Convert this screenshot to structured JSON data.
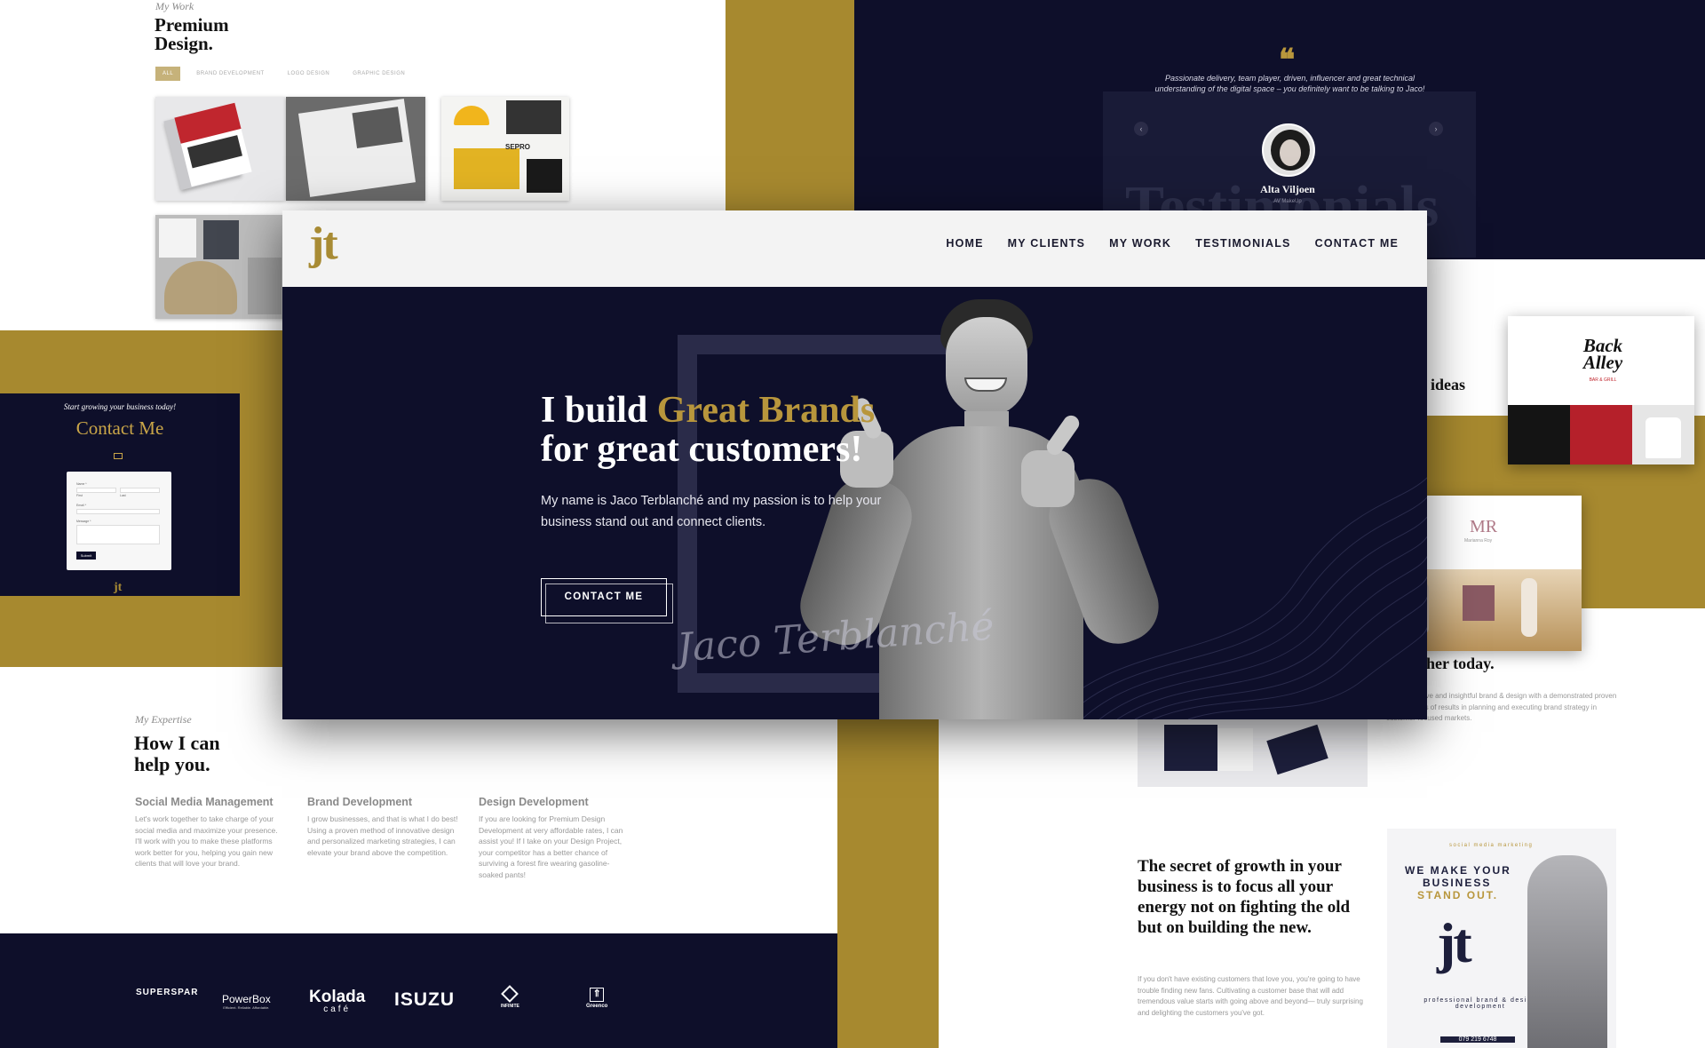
{
  "colors": {
    "navy": "#0e0f2a",
    "gold": "#a7892f",
    "accent_gold_text": "#b8963c"
  },
  "work": {
    "kicker": "My Work",
    "title_line1": "Premium",
    "title_line2": "Design.",
    "filters": [
      "ALL",
      "BRAND DEVELOPMENT",
      "LOGO DESIGN",
      "GRAPHIC DESIGN"
    ],
    "sepro_label": "SEPRO"
  },
  "testimonial": {
    "quote": "Passionate delivery, team player, driven, influencer and great technical understanding of the digital space – you definitely want to be talking to Jaco!",
    "name": "Alta Viljoen",
    "role": "AV MakeUp",
    "bg_word": "Testimonials"
  },
  "contact_section": {
    "tagline": "Start growing your business today!",
    "title": "Contact Me",
    "form": {
      "name_label": "Name *",
      "first": "First",
      "last": "Last",
      "email_label": "Email *",
      "message_label": "Message *",
      "submit": "Submit"
    },
    "footer_logo": "jt"
  },
  "header": {
    "logo": "jt",
    "nav": [
      "HOME",
      "MY CLIENTS",
      "MY WORK",
      "TESTIMONIALS",
      "CONTACT ME"
    ]
  },
  "hero": {
    "heading_pre": "I build ",
    "heading_gold": "Great Brands",
    "heading_line2": "for great customers!",
    "paragraph": "My name is Jaco Terblanché and my passion is to help your business stand out and connect clients.",
    "cta": "CONTACT ME",
    "signature": "Jaco Terblanché"
  },
  "expertise": {
    "kicker": "My Expertise",
    "title_line1": "How I can",
    "title_line2": "help you.",
    "columns": [
      {
        "title": "Social Media Management",
        "text": "Let's work together to take charge of your social media and maximize your presence. I'll work with you to make these platforms work better for you, helping you gain new clients that will love your brand."
      },
      {
        "title": "Brand Development",
        "text": "I grow businesses, and that is what I do best! Using a proven method of innovative design and personalized marketing strategies, I can elevate your brand above the competition."
      },
      {
        "title": "Design Development",
        "text": "If you are looking for Premium Design Development at very affordable rates, I can assist you! If I take on your Design Project, your competitor has a better chance of surviving a forest fire wearing gasoline-soaked pants!"
      }
    ]
  },
  "clients": [
    "SUPERSPAR",
    "PowerBox",
    "Kolada",
    "café",
    "ISUZU",
    "INFINITE",
    "Greenco"
  ],
  "clients_tagline": "Efficient. Reliable. Affordable.",
  "right": {
    "ideas_text": "ideas",
    "today_text": "her today.",
    "profile_text": "tive, innovative and insightful brand & design with a demonstrated proven 20 plus years of results in planning and executing brand strategy in customer-focused markets.",
    "secret_heading": "The secret of growth in your business is to focus all your energy not on fighting the old but on building the new.",
    "secret_text": "If you don't have existing customers that love you, you're going to have trouble finding new fans. Cultivating a customer base that will add tremendous value starts with going above and beyond— truly surprising and delighting the customers you've got.",
    "backalley": "Back Alley",
    "backalley_sub": "BAR & GRILL",
    "mr_logo": "MR",
    "mr_name": "Marianna Roy",
    "poster_top": "social media marketing",
    "poster_line1": "WE MAKE YOUR",
    "poster_line2": "BUSINESS",
    "poster_line3": "STAND OUT.",
    "poster_logo": "jt",
    "poster_sub": "professional brand & design development",
    "poster_phone": "079 219 6748"
  }
}
